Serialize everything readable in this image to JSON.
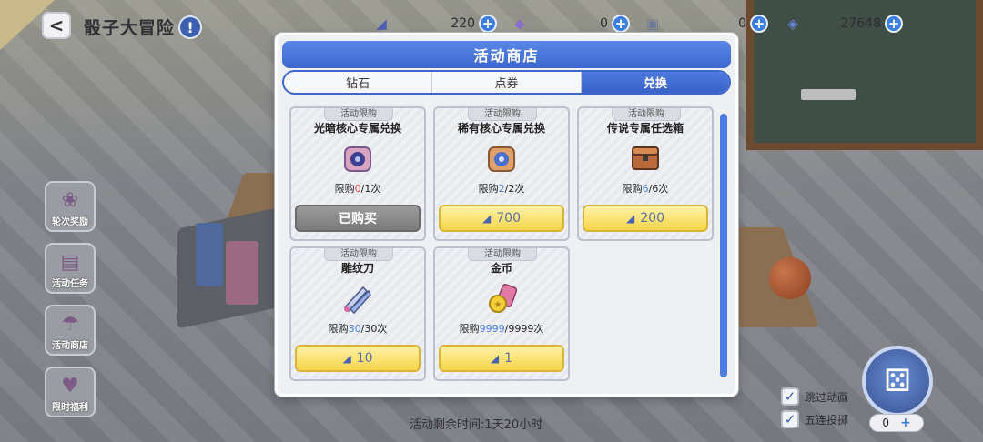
{
  "header": {
    "back_label": "<",
    "title": "骰子大冒险",
    "info_label": "!"
  },
  "currencies": [
    {
      "icon": "triangle-ruler-icon",
      "glyph": "◢",
      "value": "220"
    },
    {
      "icon": "purple-character-icon",
      "glyph": "◆",
      "value": "0"
    },
    {
      "icon": "ticket-icon",
      "glyph": "▣",
      "value": "0"
    },
    {
      "icon": "crystal-icon",
      "glyph": "◈",
      "value": "27648"
    }
  ],
  "sidebar": [
    {
      "label": "轮次奖励",
      "icon": "reward-wreath-icon",
      "glyph": "❀"
    },
    {
      "label": "活动任务",
      "icon": "task-scroll-icon",
      "glyph": "▤"
    },
    {
      "label": "活动商店",
      "icon": "shop-icon",
      "glyph": "☂"
    },
    {
      "label": "限时福利",
      "icon": "gift-icon",
      "glyph": "♥"
    }
  ],
  "modal": {
    "title": "活动商店",
    "tabs": [
      "钻石",
      "点券",
      "兑换"
    ],
    "active_tab": 2
  },
  "items": [
    {
      "tag": "活动限购",
      "name": "光暗核心专属兑换",
      "limit_prefix": "限购",
      "used": "0",
      "total": "/1次",
      "button": "已购买",
      "purchased": true,
      "used_color": "red",
      "icon": "dark-core-box-icon"
    },
    {
      "tag": "活动限购",
      "name": "稀有核心专属兑换",
      "limit_prefix": "限购",
      "used": "2",
      "total": "/2次",
      "button": "700",
      "purchased": false,
      "used_color": "blue",
      "icon": "rare-core-box-icon"
    },
    {
      "tag": "活动限购",
      "name": "传说专属任选箱",
      "limit_prefix": "限购",
      "used": "6",
      "total": "/6次",
      "button": "200",
      "purchased": false,
      "used_color": "blue",
      "icon": "legend-chest-icon"
    },
    {
      "tag": "活动限购",
      "name": "雕纹刀",
      "limit_prefix": "限购",
      "used": "30",
      "total": "/30次",
      "button": "10",
      "purchased": false,
      "used_color": "blue",
      "icon": "carving-knife-icon"
    },
    {
      "tag": "活动限购",
      "name": "金币",
      "limit_prefix": "限购",
      "used": "9999",
      "total": "/9999次",
      "button": "1",
      "purchased": false,
      "used_color": "blue",
      "icon": "gold-coin-icon"
    }
  ],
  "footer": {
    "timer": "活动剩余时间:1天20小时",
    "skip_animation": "跳过动画",
    "five_roll": "五连投掷",
    "counter_value": "0",
    "counter_plus": "+"
  },
  "colors": {
    "accent_blue": "#3e67cf",
    "buy_yellow": "#f6d548",
    "limit_red": "#e24a4a",
    "limit_blue": "#4a7ee0"
  }
}
